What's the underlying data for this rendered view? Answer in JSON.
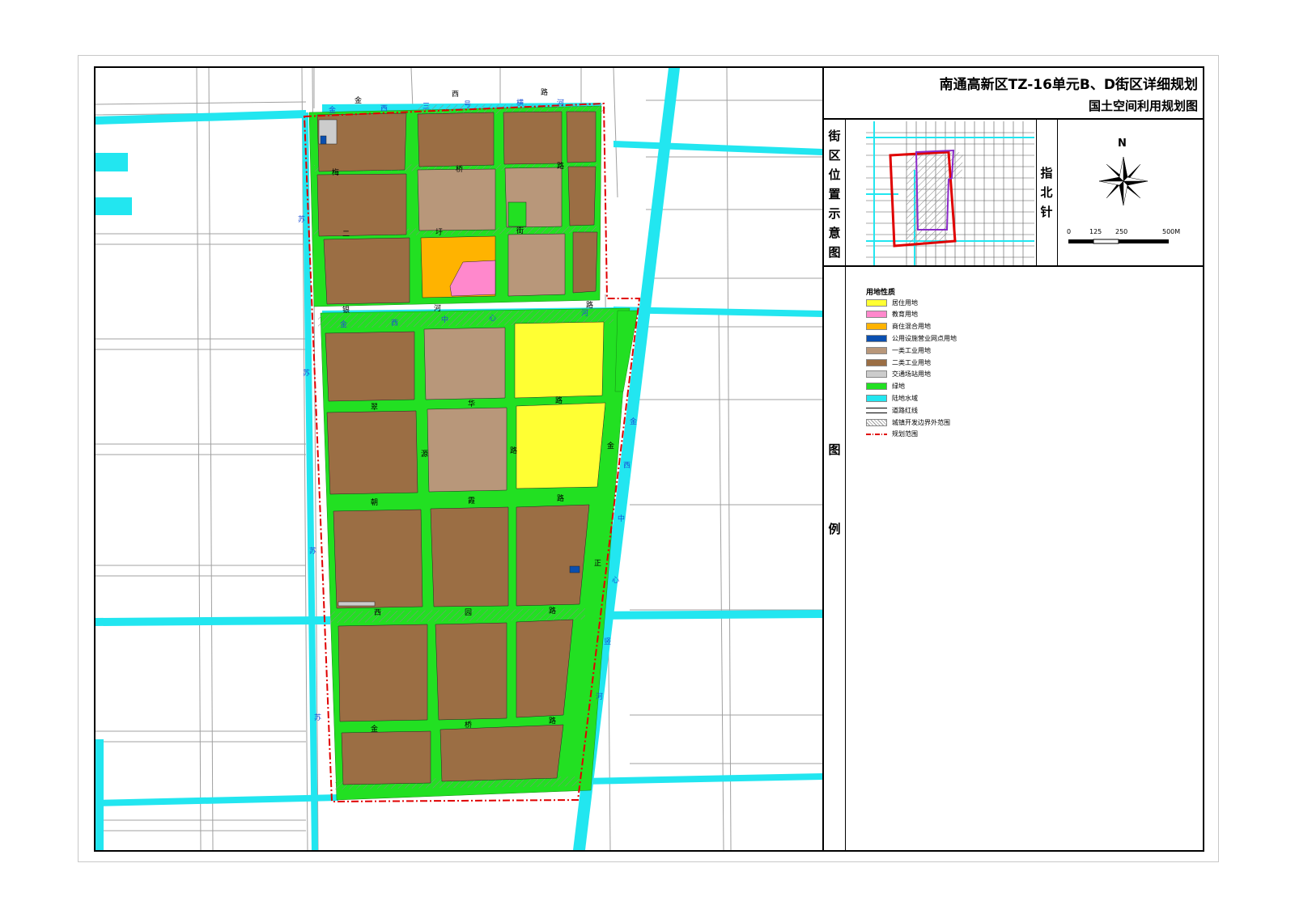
{
  "title": {
    "main": "南通高新区TZ-16单元B、D街区详细规划",
    "sub": "国土空间利用规划图"
  },
  "location_map": {
    "label_chars": [
      "街",
      "区",
      "位",
      "置",
      "示",
      "意",
      "图"
    ]
  },
  "north_arrow": {
    "label_chars": [
      "指",
      "北",
      "针"
    ],
    "north_letter": "N",
    "scale_ticks": [
      "0",
      "125",
      "250",
      "500M"
    ]
  },
  "legend": {
    "label_chars": [
      "图",
      "例"
    ],
    "title": "用地性质",
    "items": [
      {
        "label": "居住用地",
        "color": "#ffff33",
        "icon": "solid-swatch"
      },
      {
        "label": "教育用地",
        "color": "#ff88cc",
        "icon": "solid-swatch"
      },
      {
        "label": "商住混合用地",
        "color": "#ffb300",
        "icon": "solid-swatch"
      },
      {
        "label": "公用设施营业网点用地",
        "color": "#0a4fb0",
        "icon": "solid-swatch"
      },
      {
        "label": "一类工业用地",
        "color": "#b8977a",
        "icon": "solid-swatch"
      },
      {
        "label": "二类工业用地",
        "color": "#9b6e44",
        "icon": "solid-swatch"
      },
      {
        "label": "交通场站用地",
        "color": "#cccccc",
        "icon": "solid-swatch"
      },
      {
        "label": "绿地",
        "color": "#22e022",
        "icon": "solid-swatch"
      },
      {
        "label": "陆地水域",
        "color": "#22e6f0",
        "icon": "solid-swatch"
      },
      {
        "label": "道路红线",
        "color": "#000000",
        "icon": "road-line-swatch"
      },
      {
        "label": "城镇开发边界外范围",
        "color": "#999999",
        "icon": "hatch-swatch"
      },
      {
        "label": "规划范围",
        "color": "#e00000",
        "icon": "dash-dot-swatch"
      }
    ]
  },
  "map_labels": {
    "roads": [
      {
        "name": "金西路",
        "chars": [
          "金",
          "西",
          "路"
        ]
      },
      {
        "name": "梅桥路",
        "chars": [
          "梅",
          "桥",
          "路"
        ]
      },
      {
        "name": "银河路",
        "chars": [
          "银",
          "河",
          "路"
        ]
      },
      {
        "name": "翠华路",
        "chars": [
          "翠",
          "华",
          "路"
        ]
      },
      {
        "name": "朝霞路",
        "chars": [
          "朝",
          "霞",
          "路"
        ]
      },
      {
        "name": "西园路",
        "chars": [
          "西",
          "园",
          "路"
        ]
      },
      {
        "name": "金桥路",
        "chars": [
          "金",
          "桥",
          "路"
        ]
      },
      {
        "name": "二圩街",
        "chars": [
          "二",
          "圩",
          "街"
        ]
      },
      {
        "name": "源头路",
        "chars": [
          "源",
          "路"
        ]
      },
      {
        "name": "金正路",
        "chars": [
          "金",
          "正"
        ]
      }
    ],
    "rivers": [
      {
        "name": "金西三号横河",
        "chars": [
          "金",
          "西",
          "三",
          "号",
          "横",
          "河"
        ]
      },
      {
        "name": "金西中心河",
        "chars": [
          "金",
          "西",
          "中",
          "心",
          "河"
        ]
      },
      {
        "name": "金西中心竖河",
        "chars": [
          "金",
          "西",
          "中",
          "心",
          "竖",
          "河"
        ]
      },
      {
        "name": "苏通大道",
        "chars": [
          "苏",
          "苏",
          "苏",
          "苏"
        ]
      }
    ]
  }
}
